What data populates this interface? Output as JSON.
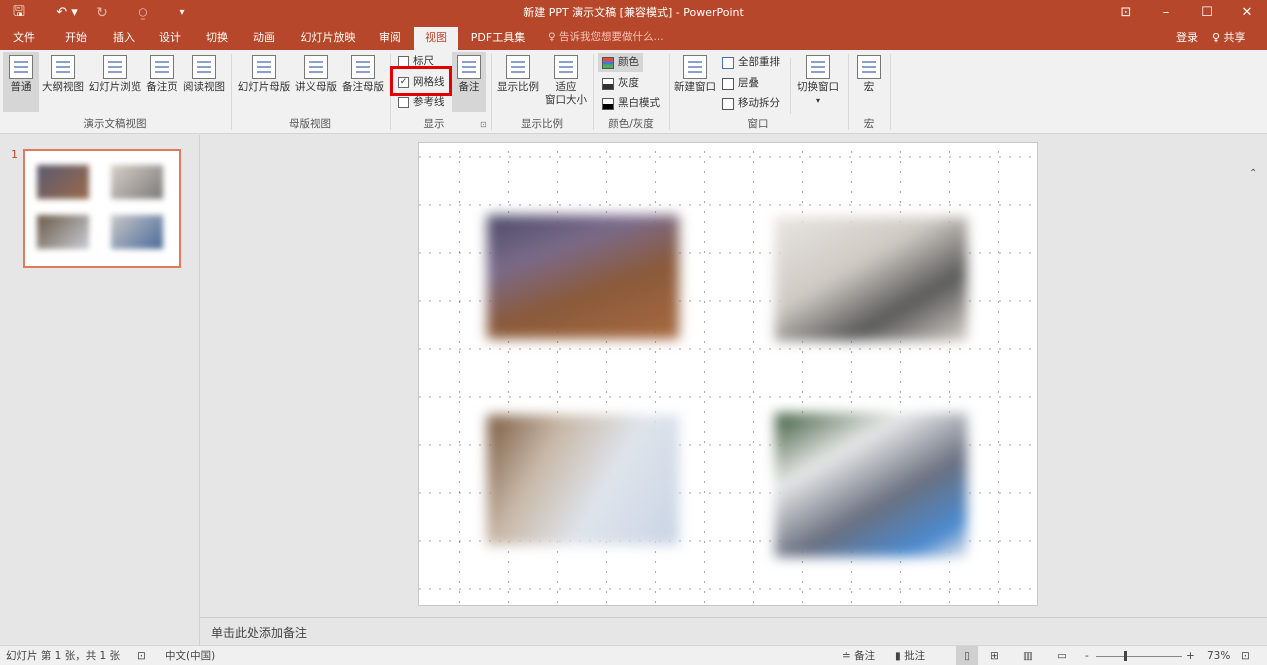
{
  "window": {
    "title": "新建 PPT 演示文稿 [兼容模式] - PowerPoint",
    "quick_access": {
      "save": "🖫",
      "undo": "↶ ▾",
      "redo": "↻",
      "start": "⍜",
      "customize": "▾"
    },
    "controls": {
      "ribbon_display": "⊡",
      "minimize": "–",
      "maximize": "☐",
      "close": "✕"
    }
  },
  "tabs": [
    "文件",
    "开始",
    "插入",
    "设计",
    "切换",
    "动画",
    "幻灯片放映",
    "审阅",
    "视图",
    "PDF工具集"
  ],
  "active_tab": "视图",
  "tell_me": "♀ 告诉我您想要做什么...",
  "account": {
    "signin": "登录",
    "share": "♀ 共享"
  },
  "ribbon": {
    "presentation_views": {
      "label": "演示文稿视图",
      "buttons": [
        "普通",
        "大纲视图",
        "幻灯片浏览",
        "备注页",
        "阅读视图"
      ]
    },
    "master_views": {
      "label": "母版视图",
      "buttons": [
        "幻灯片母版",
        "讲义母版",
        "备注母版"
      ]
    },
    "show": {
      "label": "显示",
      "ruler": "标尺",
      "gridlines": "网格线",
      "guides": "参考线",
      "notes": "备注",
      "launcher": "⊡"
    },
    "zoom": {
      "label": "显示比例",
      "zoom": "显示比例",
      "fit1": "适应",
      "fit2": "窗口大小"
    },
    "color": {
      "label": "颜色/灰度",
      "color": "颜色",
      "grayscale": "灰度",
      "bw": "黑白模式"
    },
    "window": {
      "label": "窗口",
      "new_window": "新建窗口",
      "arrange_all": "全部重排",
      "cascade": "层叠",
      "move_split": "移动拆分"
    },
    "switch": {
      "label": "切换窗口"
    },
    "macro": {
      "label": "宏",
      "button": "宏"
    },
    "collapse": "⌃"
  },
  "slides_panel": {
    "number": "1"
  },
  "notes_placeholder": "单击此处添加备注",
  "status": {
    "slide_info": "幻灯片 第 1 张，共 1 张",
    "spell_icon": "⊡",
    "language": "中文(中国)",
    "notes": "≐ 备注",
    "comments": "▮ 批注",
    "zoom_minus": "-",
    "zoom_plus": "+",
    "zoom": "73%",
    "fit": "⊡"
  }
}
